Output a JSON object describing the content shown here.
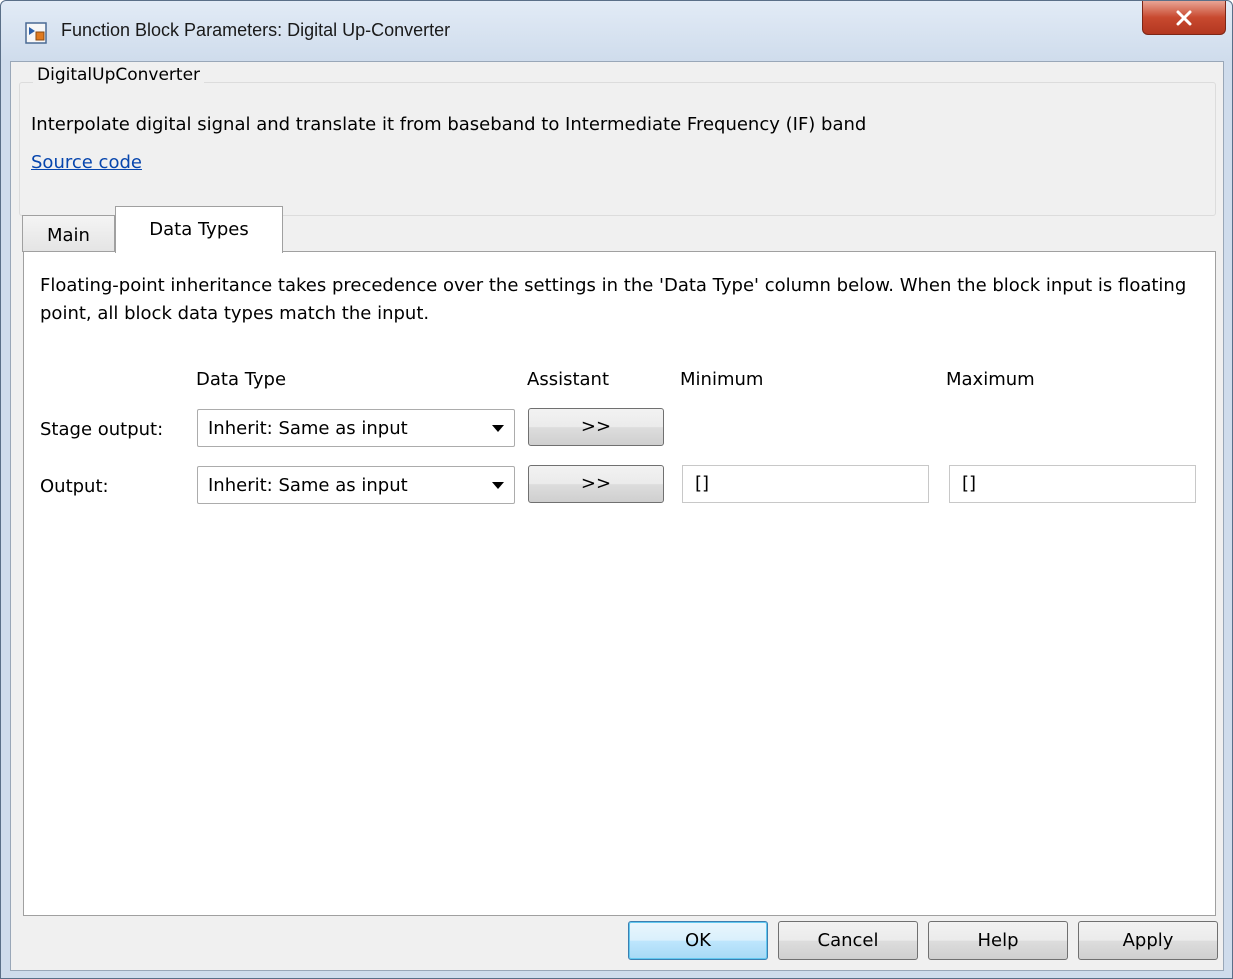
{
  "window": {
    "title": "Function Block Parameters: Digital Up-Converter",
    "icon": "simulink-block-icon",
    "close_icon": "close-icon"
  },
  "block": {
    "name": "DigitalUpConverter",
    "description": "Interpolate digital signal and translate it from baseband to Intermediate Frequency (IF) band",
    "source_link": "Source code"
  },
  "tabs": [
    {
      "label": "Main",
      "selected": false
    },
    {
      "label": "Data Types",
      "selected": true
    }
  ],
  "data_types": {
    "note": "Floating-point inheritance takes precedence over the settings in the 'Data Type' column below. When the block input is floating point, all block data types match the input.",
    "columns": {
      "data_type": "Data Type",
      "assistant": "Assistant",
      "minimum": "Minimum",
      "maximum": "Maximum"
    },
    "rows": [
      {
        "label": "Stage output:",
        "data_type": "Inherit: Same as input",
        "assistant": ">>"
      },
      {
        "label": "Output:",
        "data_type": "Inherit: Same as input",
        "assistant": ">>",
        "minimum": "[]",
        "maximum": "[]"
      }
    ]
  },
  "buttons": {
    "ok": "OK",
    "cancel": "Cancel",
    "help": "Help",
    "apply": "Apply"
  },
  "colors": {
    "titlebar": "#cfdcec",
    "close_button": "#c8492f",
    "link": "#0645ad",
    "ok_button": "#bee6fd"
  }
}
